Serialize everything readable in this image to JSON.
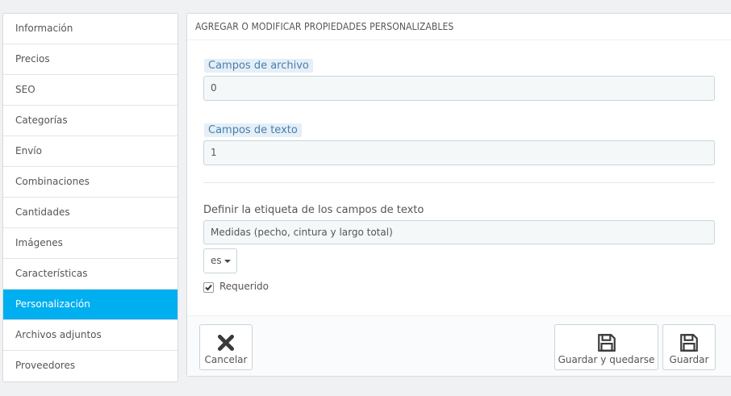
{
  "sidebar": {
    "items": [
      {
        "label": "Información"
      },
      {
        "label": "Precios"
      },
      {
        "label": "SEO"
      },
      {
        "label": "Categorías"
      },
      {
        "label": "Envío"
      },
      {
        "label": "Combinaciones"
      },
      {
        "label": "Cantidades"
      },
      {
        "label": "Imágenes"
      },
      {
        "label": "Características"
      },
      {
        "label": "Personalización",
        "active": true
      },
      {
        "label": "Archivos adjuntos"
      },
      {
        "label": "Proveedores"
      }
    ]
  },
  "panel": {
    "title": "AGREGAR O MODIFICAR PROPIEDADES PERSONALIZABLES",
    "file_fields": {
      "label": "Campos de archivo",
      "value": "0"
    },
    "text_fields": {
      "label": "Campos de texto",
      "value": "1"
    },
    "text_field_label": {
      "label": "Definir la etiqueta de los campos de texto",
      "value": "Medidas (pecho, cintura y largo total)"
    },
    "language": {
      "selected": "es"
    },
    "required": {
      "label": "Requerido",
      "checked": true
    }
  },
  "footer": {
    "cancel_label": "Cancelar",
    "save_stay_label": "Guardar y quedarse",
    "save_label": "Guardar"
  },
  "icons": {
    "cancel": "close-icon",
    "save_stay": "floppy-disk-icon",
    "save": "floppy-disk-icon"
  },
  "colors": {
    "active_tab": "#00aff0",
    "label_highlight": "#e4eff8"
  }
}
